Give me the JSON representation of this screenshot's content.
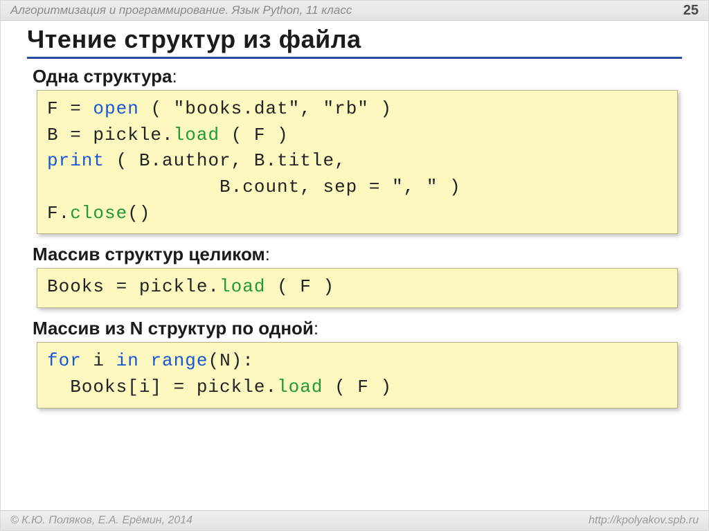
{
  "header": {
    "course": "Алгоритмизация и программирование. Язык Python, 11 класс",
    "page": "25"
  },
  "title": "Чтение структур из файла",
  "sections": [
    {
      "heading_pre": "Одна структура",
      "heading_post": ":"
    },
    {
      "heading_pre": "Массив структур целиком",
      "heading_post": ":"
    },
    {
      "heading_pre": "Массив из N структур по одной",
      "heading_post": ":"
    }
  ],
  "code": {
    "c1": {
      "l1a": "F = ",
      "l1b": "open",
      "l1c": " ( \"books.dat\", \"rb\" )",
      "l2a": "B = pickle.",
      "l2b": "load",
      "l2c": " ( F )",
      "l3a": "print",
      "l3b": " ( B.author, B.title,",
      "l4": "               B.count, sep = \", \" )",
      "l5a": "F.",
      "l5b": "close",
      "l5c": "()"
    },
    "c2": {
      "l1a": "Books = pickle.",
      "l1b": "load",
      "l1c": " ( F )"
    },
    "c3": {
      "l1a": "for",
      "l1b": " i ",
      "l1c": "in",
      "l1d": " ",
      "l1e": "range",
      "l1f": "(N):",
      "l2a": "  Books[i] = pickle.",
      "l2b": "load",
      "l2c": " ( F )"
    }
  },
  "footer": {
    "copyright": "© К.Ю. Поляков, Е.А. Ерёмин, 2014",
    "url": "http://kpolyakov.spb.ru"
  }
}
